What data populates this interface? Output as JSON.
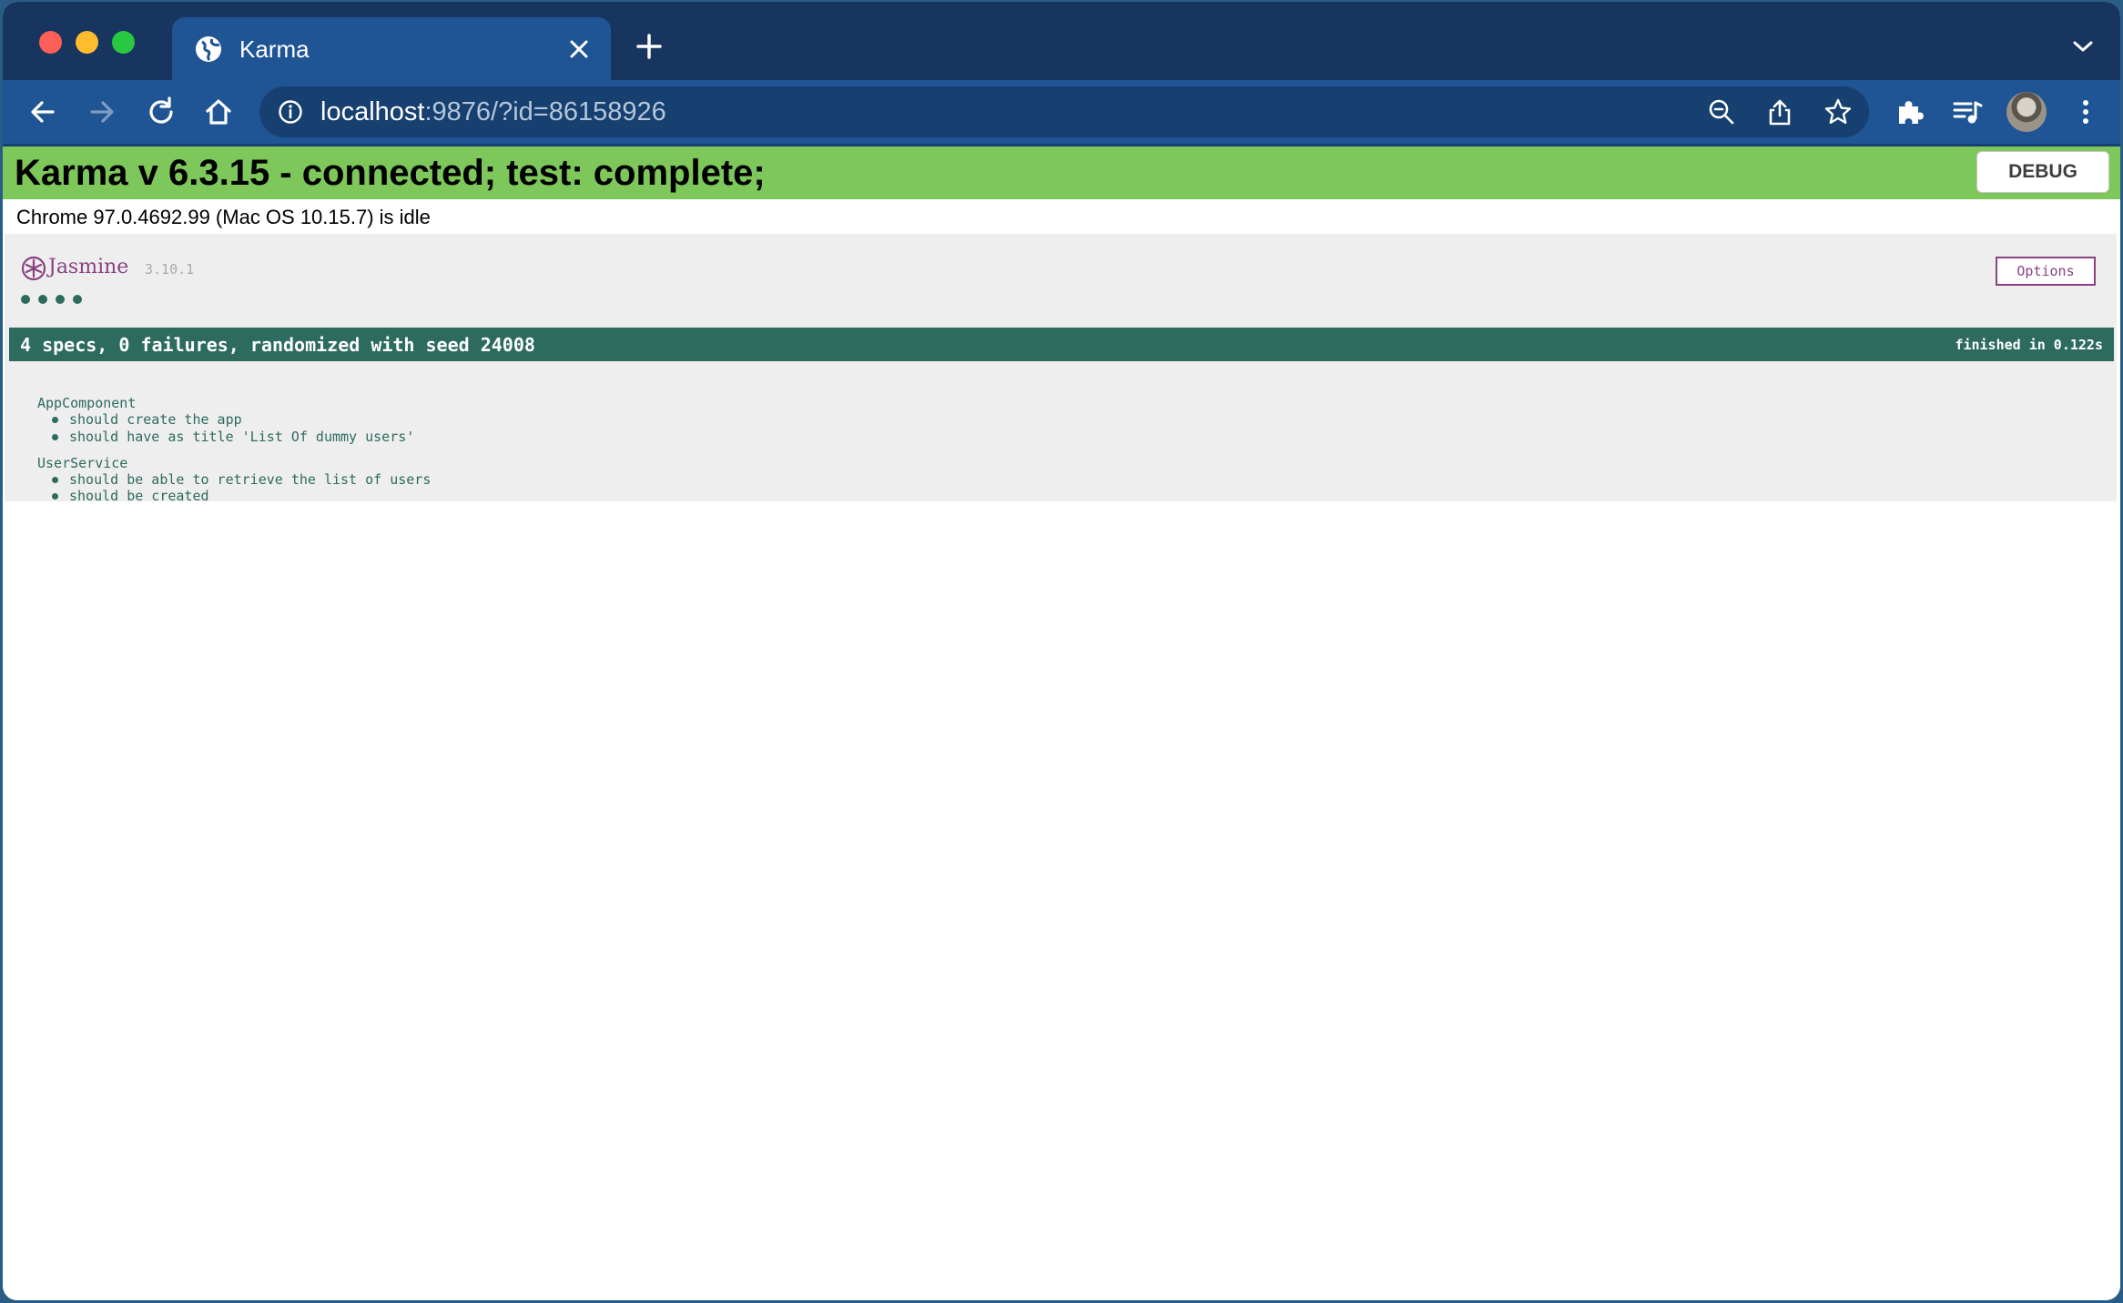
{
  "browser": {
    "tab_title": "Karma",
    "url_host": "localhost",
    "url_rest": ":9876/?id=86158926"
  },
  "karma": {
    "banner_title": "Karma v 6.3.15 - connected; test: complete;",
    "debug_label": "DEBUG",
    "browser_status": "Chrome 97.0.4692.99 (Mac OS 10.15.7) is idle"
  },
  "jasmine": {
    "name": "Jasmine",
    "version": "3.10.1",
    "options_label": "Options",
    "dots_count": 4,
    "summary": "4 specs, 0 failures, randomized with seed 24008",
    "finished": "finished in 0.122s",
    "suites": [
      {
        "name": "AppComponent",
        "specs": [
          "should create the app",
          "should have as title 'List Of dummy users'"
        ]
      },
      {
        "name": "UserService",
        "specs": [
          "should be able to retrieve the list of users",
          "should be created"
        ]
      }
    ]
  },
  "colors": {
    "chrome_tabstrip": "#17355e",
    "chrome_toolbar": "#1f5594",
    "karma_green": "#7ec75a",
    "jasmine_passed": "#2d6b5f",
    "jasmine_purple": "#8a4182"
  }
}
